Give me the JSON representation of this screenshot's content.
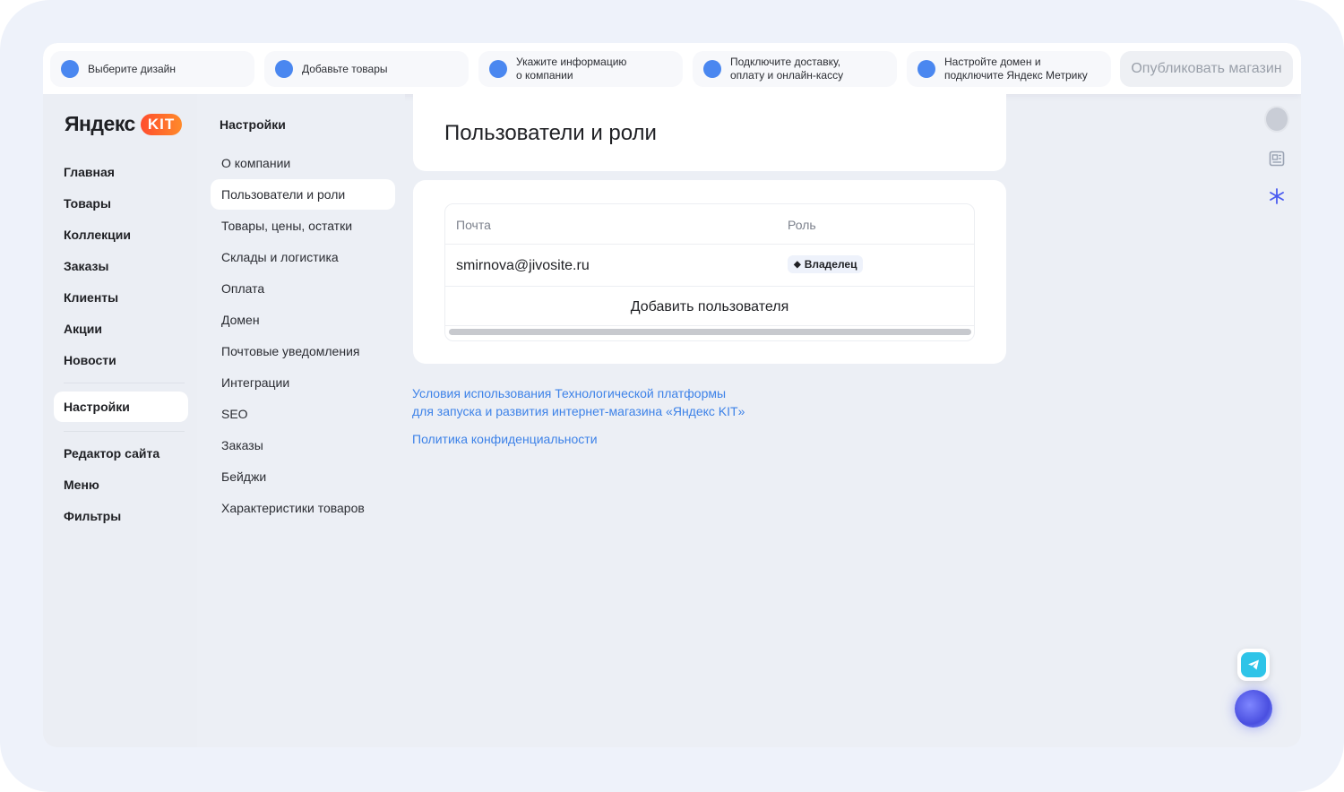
{
  "onboarding": {
    "steps": [
      {
        "label": "Выберите дизайн"
      },
      {
        "label": "Добавьте товары"
      },
      {
        "label_line1": "Укажите информацию",
        "label_line2": "о компании"
      },
      {
        "label_line1": "Подключите доставку,",
        "label_line2": "оплату и онлайн-кассу"
      },
      {
        "label_line1": "Настройте домен и",
        "label_line2": "подключите Яндекс Метрику"
      }
    ],
    "publish_label": "Опубликовать магазин"
  },
  "brand": {
    "name": "Яндекс",
    "badge": "KIT"
  },
  "sidebar": {
    "items": [
      "Главная",
      "Товары",
      "Коллекции",
      "Заказы",
      "Клиенты",
      "Акции",
      "Новости"
    ],
    "active": "Настройки",
    "bottom_items": [
      "Редактор сайта",
      "Меню",
      "Фильтры"
    ]
  },
  "settings_nav": {
    "title": "Настройки",
    "items": [
      "О компании",
      "Пользователи и роли",
      "Товары, цены, остатки",
      "Склады и логистика",
      "Оплата",
      "Домен",
      "Почтовые уведомления",
      "Интеграции",
      "SEO",
      "Заказы",
      "Бейджи",
      "Характеристики товаров"
    ]
  },
  "main": {
    "title": "Пользователи и роли",
    "table": {
      "col_email": "Почта",
      "col_role": "Роль",
      "rows": [
        {
          "email": "smirnova@jivosite.ru",
          "role": "Владелец"
        }
      ],
      "add_label": "Добавить пользователя"
    },
    "links": {
      "terms_line1": "Условия использования Технологической платформы",
      "terms_line2": "для запуска и развития интернет-магазина «Яндекс KIT»",
      "privacy": "Политика конфиденциальности"
    }
  },
  "icons": {
    "right_rail": [
      "avatar-icon",
      "document-icon",
      "snowflake-icon"
    ],
    "fabs": [
      "telegram-icon",
      "ai-assistant-icon"
    ]
  },
  "colors": {
    "accent": "#4a87f0",
    "link": "#3d82e8",
    "kit_badge": "#ff5a2c"
  }
}
